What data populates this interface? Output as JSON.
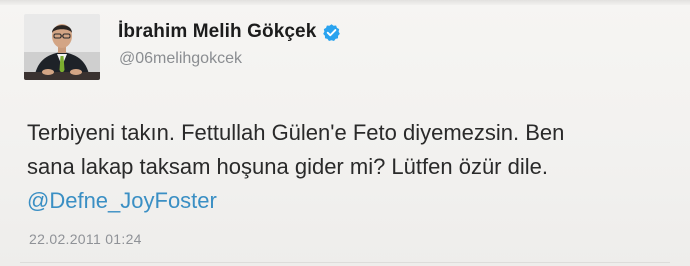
{
  "tweet": {
    "display_name": "İbrahim Melih Gökçek",
    "handle": "@06melihgokcek",
    "verified": true,
    "body_lines": [
      "Terbiyeni takın. Fettullah Gülen'e Feto diyemezsin. Ben",
      "sana lakap taksam hoşuna gider mi? Lütfen özür dile."
    ],
    "mention": "@Defne_JoyFoster",
    "timestamp": "22.02.2011 01:24"
  },
  "colors": {
    "background": "#f4f3f1",
    "name": "#1c1c1c",
    "handle": "#8a8d91",
    "body": "#2a2a2a",
    "mention": "#3a8fc4",
    "verified_badge": "#1da1f2",
    "timestamp": "#8f9297"
  },
  "icons": {
    "verified": "verified-badge-icon",
    "avatar": "profile-photo"
  }
}
